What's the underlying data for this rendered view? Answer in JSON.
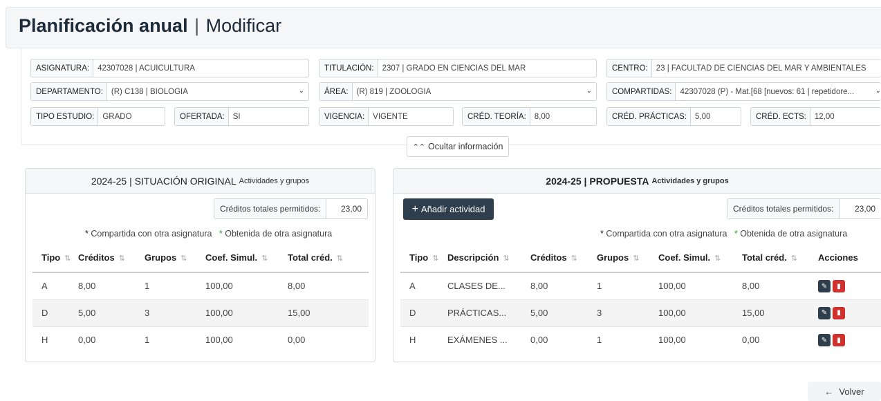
{
  "header": {
    "title_bold": "Planificación anual",
    "separator": "|",
    "title_light": "Modificar"
  },
  "info": {
    "asignatura": {
      "label": "ASIGNATURA:",
      "value": "42307028 | ACUICULTURA"
    },
    "titulacion": {
      "label": "TITULACIÓN:",
      "value": "2307 | GRADO EN CIENCIAS DEL MAR"
    },
    "centro": {
      "label": "CENTRO:",
      "value": "23 | FACULTAD DE CIENCIAS DEL MAR Y AMBIENTALES"
    },
    "departamento": {
      "label": "DEPARTAMENTO:",
      "value": "(R) C138 | BIOLOGIA"
    },
    "area": {
      "label": "ÁREA:",
      "value": "(R) 819 | ZOOLOGIA"
    },
    "compartidas": {
      "label": "COMPARTIDAS:",
      "value": "42307028 (P) - Mat.[68 [nuevos: 61 | repetidore..."
    },
    "tipo_estudio": {
      "label": "TIPO ESTUDIO:",
      "value": "GRADO"
    },
    "ofertada": {
      "label": "OFERTADA:",
      "value": "SÍ"
    },
    "vigencia": {
      "label": "VIGENCIA:",
      "value": "VIGENTE"
    },
    "cred_teoria": {
      "label": "CRÉD. TEORÍA:",
      "value": "8,00"
    },
    "cred_practicas": {
      "label": "CRÉD. PRÁCTICAS:",
      "value": "5,00"
    },
    "cred_ects": {
      "label": "CRÉD. ECTS:",
      "value": "12,00"
    },
    "toggle_label": "Ocultar información"
  },
  "original": {
    "heading_main": "2024-25 | SITUACIÓN ORIGINAL",
    "heading_sub": "Actividades y grupos",
    "credits_label": "Créditos totales permitidos:",
    "credits_value": "23,00",
    "legend_shared": "Compartida con otra asignatura",
    "legend_obtained": "Obtenida de otra asignatura",
    "columns": [
      "Tipo",
      "Créditos",
      "Grupos",
      "Coef. Simul.",
      "Total créd."
    ],
    "rows": [
      [
        "A",
        "8,00",
        "1",
        "100,00",
        "8,00"
      ],
      [
        "D",
        "5,00",
        "3",
        "100,00",
        "15,00"
      ],
      [
        "H",
        "0,00",
        "1",
        "100,00",
        "0,00"
      ]
    ]
  },
  "propuesta": {
    "heading_main": "2024-25 | PROPUESTA",
    "heading_sub": "Actividades y grupos",
    "add_label": "Añadir actividad",
    "credits_label": "Créditos totales permitidos:",
    "credits_value": "23,00",
    "legend_shared": "Compartida con otra asignatura",
    "legend_obtained": "Obtenida de otra asignatura",
    "columns": [
      "Tipo",
      "Descripción",
      "Créditos",
      "Grupos",
      "Coef. Simul.",
      "Total créd.",
      "Acciones"
    ],
    "rows": [
      [
        "A",
        "CLASES DE...",
        "8,00",
        "1",
        "100,00",
        "8,00"
      ],
      [
        "D",
        "PRÁCTICAS...",
        "5,00",
        "3",
        "100,00",
        "15,00"
      ],
      [
        "H",
        "EXÁMENES ...",
        "0,00",
        "1",
        "100,00",
        "0,00"
      ]
    ]
  },
  "footer": {
    "back_label": "Volver"
  },
  "colors": {
    "primary_dark": "#2e3e4c",
    "danger": "#d0312d",
    "obtained_star": "#2aa12a"
  },
  "icons": {
    "toggle": "double-chevron-up-icon",
    "add": "plus-icon",
    "edit": "edit-icon",
    "delete": "trash-icon",
    "back": "arrow-left-icon",
    "sort": "sort-icon",
    "caret": "chevron-down-icon"
  }
}
